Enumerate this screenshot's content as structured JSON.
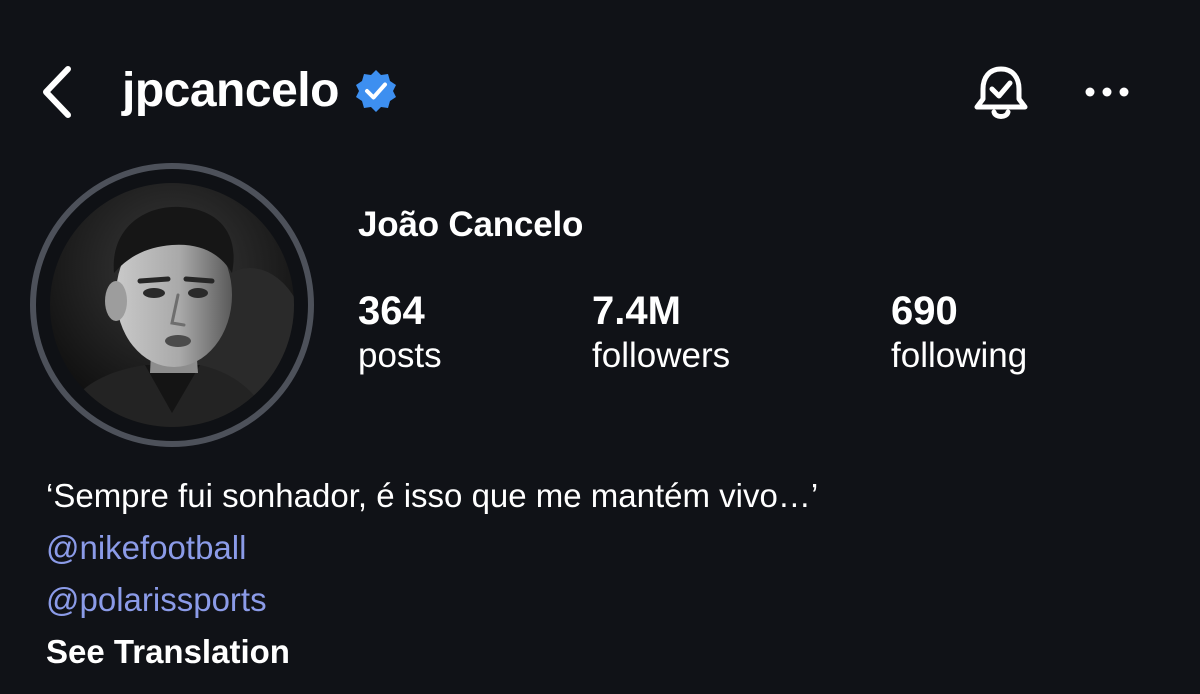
{
  "header": {
    "username": "jpcancelo",
    "verified": true,
    "back_icon": "chevron-left-icon",
    "verified_icon": "verified-badge-icon",
    "bell_icon": "bell-check-icon",
    "more_icon": "more-horizontal-icon"
  },
  "profile": {
    "display_name": "João Cancelo",
    "stats": [
      {
        "value": "364",
        "label": "posts"
      },
      {
        "value": "7.4M",
        "label": "followers"
      },
      {
        "value": "690",
        "label": "following"
      }
    ],
    "bio": {
      "quote": "‘Sempre fui sonhador, é isso que me mantém vivo…’",
      "mentions": [
        "@nikefootball",
        "@polarissports"
      ],
      "translate_label": "See Translation"
    }
  },
  "colors": {
    "background": "#101217",
    "text": "#ffffff",
    "mention": "#8b9be8",
    "verified": "#3d8ff0",
    "avatar_ring": "#4d515a"
  }
}
